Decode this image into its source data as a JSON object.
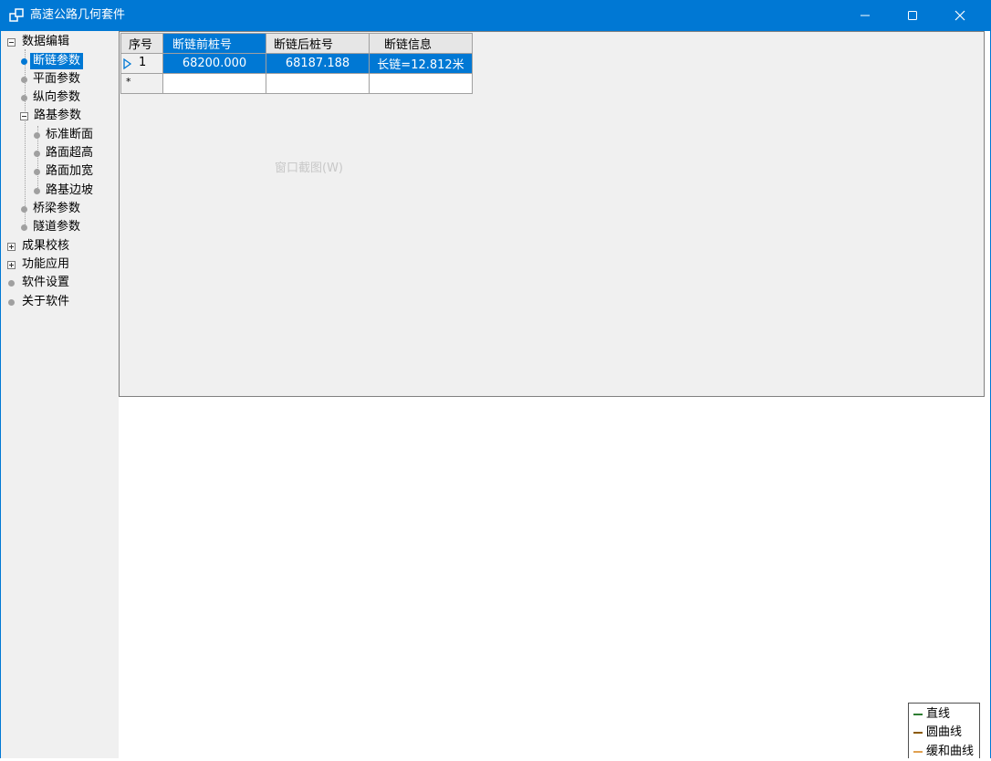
{
  "window": {
    "title": "高速公路几何套件"
  },
  "tree": {
    "root_data": "数据编辑",
    "chain_params": "断链参数",
    "plane_params": "平面参数",
    "vertical_params": "纵向参数",
    "subgrade_params": "路基参数",
    "std_section": "标准断面",
    "superelevation": "路面超高",
    "widening": "路面加宽",
    "slope": "路基边坡",
    "bridge_params": "桥梁参数",
    "tunnel_params": "隧道参数",
    "result_check": "成果校核",
    "func_apply": "功能应用",
    "settings": "软件设置",
    "about": "关于软件"
  },
  "grid": {
    "headers": [
      "序号",
      "断链前桩号",
      "断链后桩号",
      "断链信息"
    ],
    "rows": [
      {
        "index": "1",
        "before": "68200.000",
        "after": "68187.188",
        "info": "长链=12.812米"
      }
    ],
    "new_row_marker": "*"
  },
  "watermark": "窗口截图(W)",
  "legend": {
    "items": [
      {
        "label": "直线",
        "color": "#2e7d32"
      },
      {
        "label": "圆曲线",
        "color": "#8b5a00"
      },
      {
        "label": "缓和曲线",
        "color": "#e0a050"
      }
    ]
  },
  "colors": {
    "accent": "#0078d4"
  }
}
